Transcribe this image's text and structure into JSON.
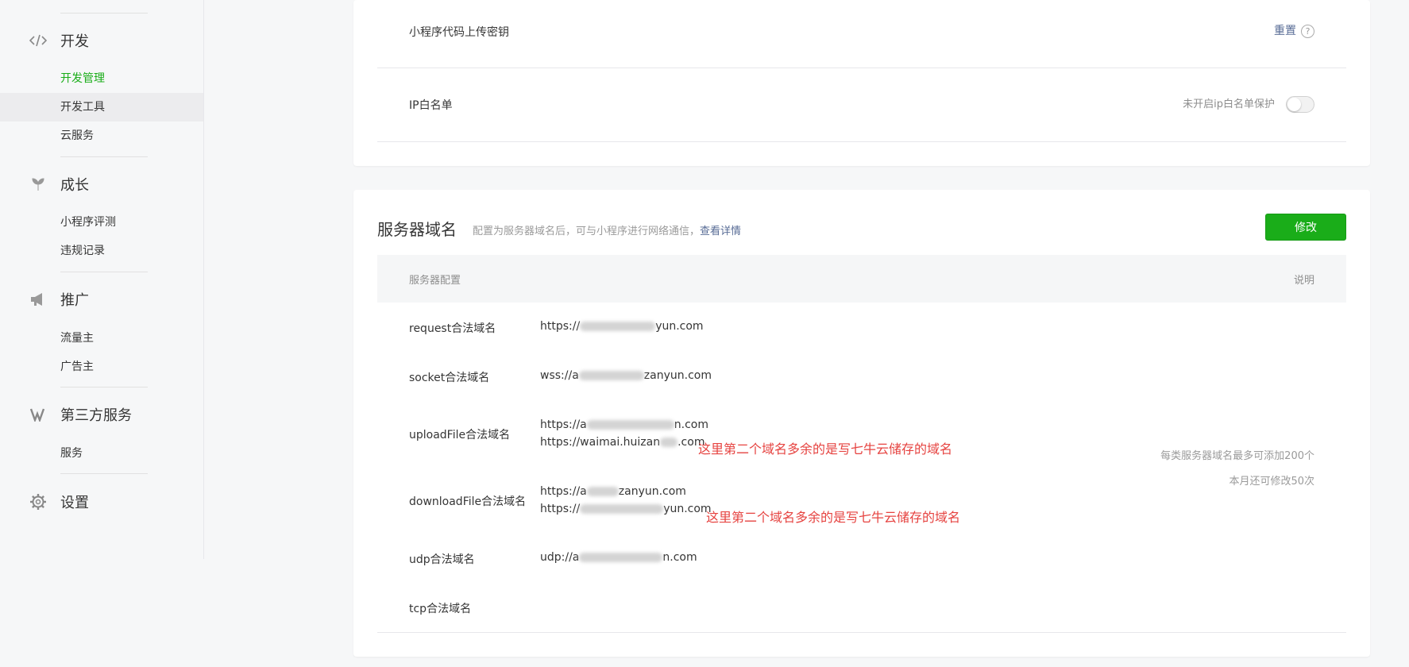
{
  "sidebar": {
    "groups": [
      {
        "title": "开发",
        "icon": "code-icon",
        "items": [
          {
            "label": "开发管理"
          },
          {
            "label": "开发工具"
          },
          {
            "label": "云服务"
          }
        ]
      },
      {
        "title": "成长",
        "icon": "sprout-icon",
        "items": [
          {
            "label": "小程序评测"
          },
          {
            "label": "违规记录"
          }
        ]
      },
      {
        "title": "推广",
        "icon": "megaphone-icon",
        "items": [
          {
            "label": "流量主"
          },
          {
            "label": "广告主"
          }
        ]
      },
      {
        "title": "第三方服务",
        "icon": "third-party-icon",
        "items": [
          {
            "label": "服务"
          }
        ]
      },
      {
        "title": "设置",
        "icon": "gear-icon",
        "items": []
      }
    ]
  },
  "settings": {
    "upload_key": {
      "label": "小程序代码上传密钥",
      "action": "重置",
      "help": "?"
    },
    "ip_whitelist": {
      "label": "IP白名单",
      "status": "未开启ip白名单保护"
    }
  },
  "server_domain": {
    "title": "服务器域名",
    "desc": "配置为服务器域名后，可与小程序进行网络通信，",
    "desc_link": "查看详情",
    "edit_button": "修改",
    "table_header": {
      "config": "服务器配置",
      "note": "说明"
    },
    "rows": [
      {
        "label": "request合法域名",
        "values": [
          {
            "prefix": "https://",
            "suffix": "yun.com"
          }
        ]
      },
      {
        "label": "socket合法域名",
        "values": [
          {
            "prefix": "wss://a",
            "suffix": "zanyun.com"
          }
        ]
      },
      {
        "label": "uploadFile合法域名",
        "values": [
          {
            "prefix": "https://a",
            "suffix": "n.com"
          },
          {
            "prefix": "https://waimai.huizan",
            "suffix": ".com"
          }
        ]
      },
      {
        "label": "downloadFile合法域名",
        "values": [
          {
            "prefix": "https://a",
            "suffix": "zanyun.com"
          },
          {
            "prefix": "https://",
            "suffix": "yun.com"
          }
        ]
      },
      {
        "label": "udp合法域名",
        "values": [
          {
            "prefix": "udp://a",
            "suffix": "n.com"
          }
        ]
      },
      {
        "label": "tcp合法域名",
        "values": []
      }
    ],
    "annotation": "这里第二个域名多余的是写七牛云储存的域名",
    "notes": [
      "每类服务器域名最多可添加200个",
      "本月还可修改50次"
    ]
  }
}
